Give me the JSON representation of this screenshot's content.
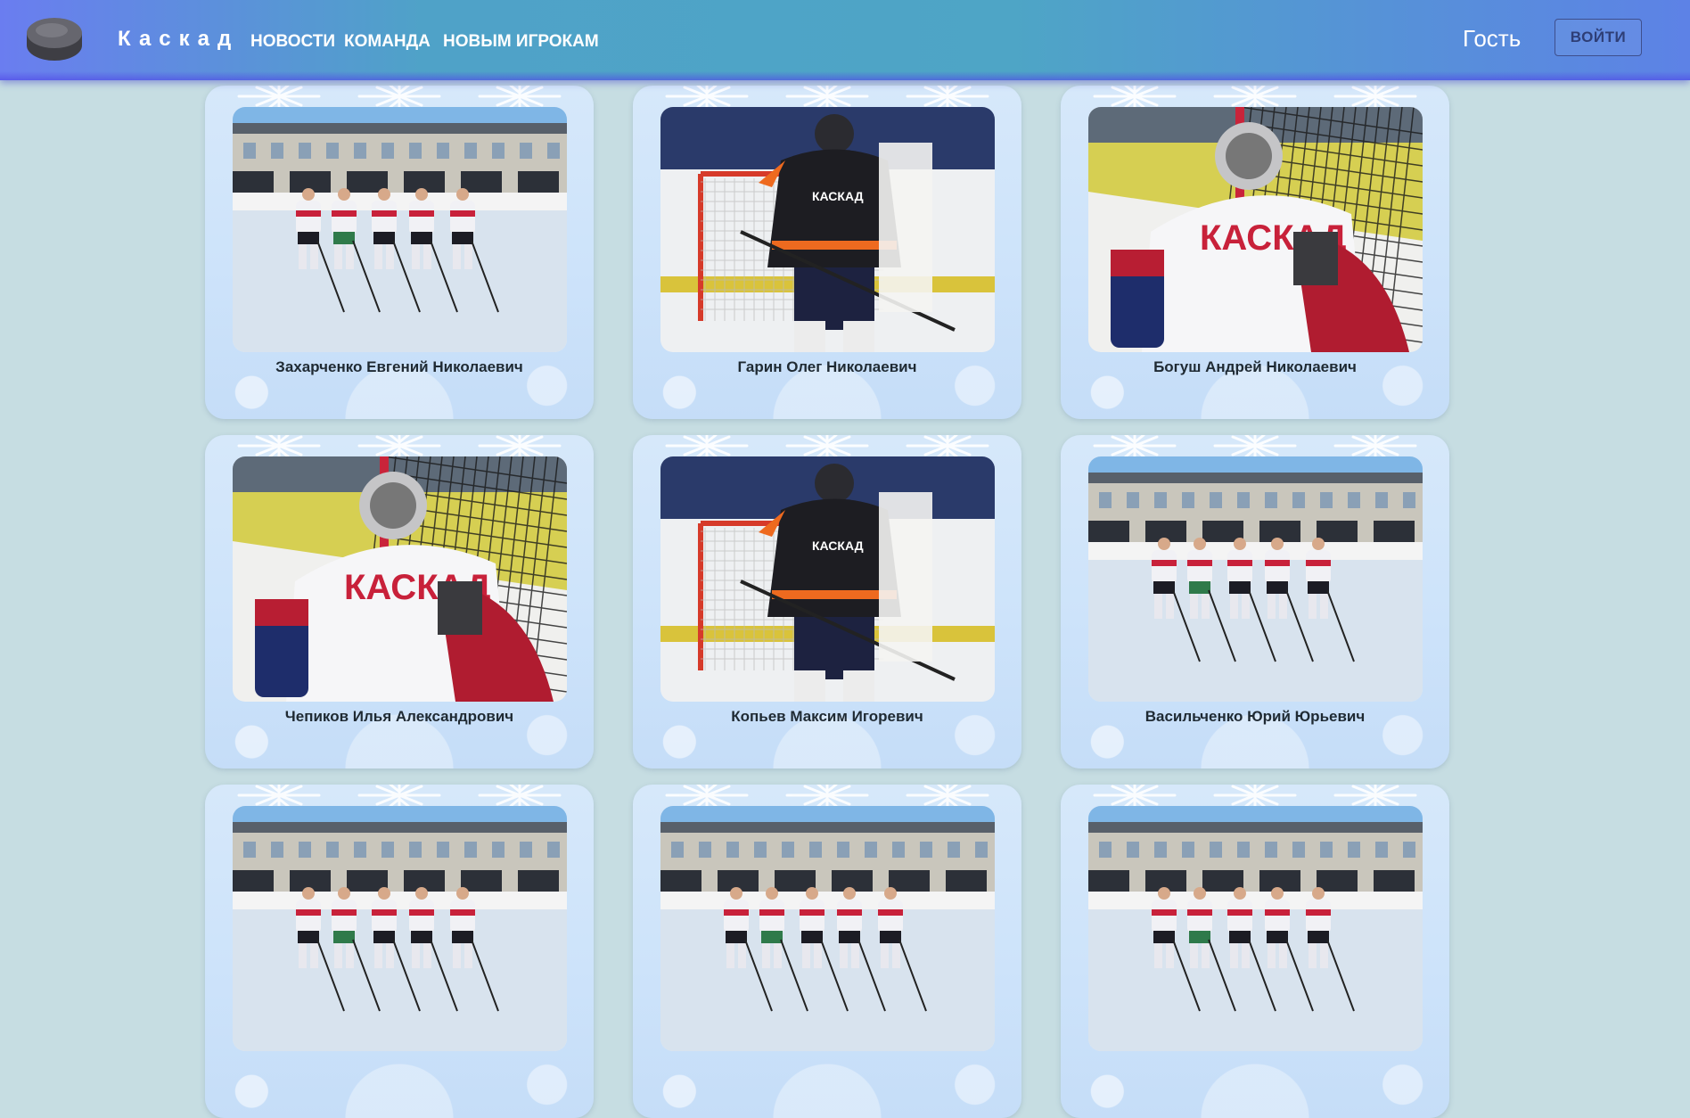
{
  "header": {
    "brand": "Каскад",
    "nav": [
      "НОВОСТИ",
      "КОМАНДА",
      "НОВЫМ ИГРОКАМ"
    ],
    "guest_label": "Гость",
    "login_label": "ВОЙТИ"
  },
  "players": [
    {
      "name": "Захарченко Евгений Николаевич",
      "photo": "team-photo"
    },
    {
      "name": "Гарин Олег Николаевич",
      "photo": "player-photo-dark-jersey"
    },
    {
      "name": "Богуш Андрей Николаевич",
      "photo": "goalie-photo"
    },
    {
      "name": "Чепиков Илья Александрович",
      "photo": "goalie-photo"
    },
    {
      "name": "Копьев Максим Игоревич",
      "photo": "player-photo-dark-jersey"
    },
    {
      "name": "Васильченко Юрий Юрьевич",
      "photo": "team-photo"
    },
    {
      "name": "",
      "photo": "team-photo"
    },
    {
      "name": "",
      "photo": "team-photo"
    },
    {
      "name": "",
      "photo": "team-photo"
    }
  ],
  "colors": {
    "page_bg": "#c6dde2",
    "header_start": "#6a7df0",
    "header_mid": "#4ea5c6",
    "card_bg": "#d2e6fa"
  }
}
